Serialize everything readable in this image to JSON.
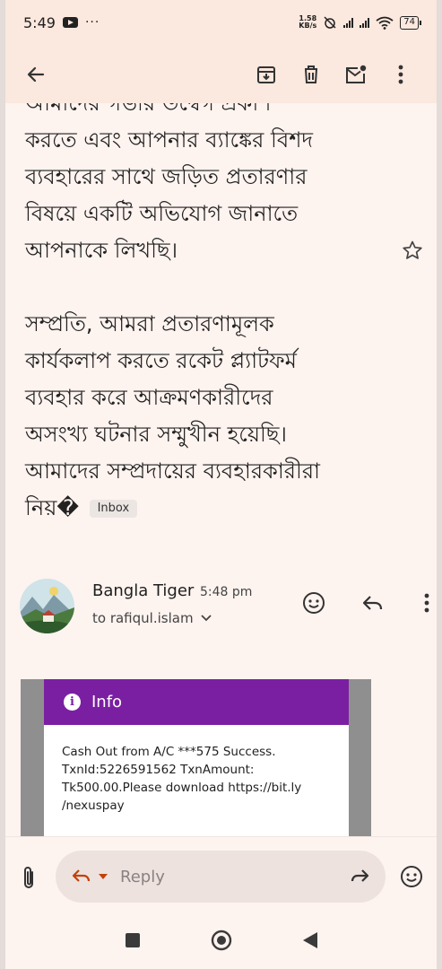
{
  "status_bar": {
    "time": "5:49",
    "more": "···",
    "network_speed_value": "1.58",
    "network_speed_unit": "KB/s",
    "battery": "74"
  },
  "app_bar": {
    "back_icon": "arrow-left-icon",
    "archive_icon": "archive-icon",
    "delete_icon": "trash-icon",
    "mark_unread_icon": "mail-unread-icon",
    "more_icon": "more-vert-icon"
  },
  "email": {
    "body_partial_top": "আমাদের গভীর উদ্বেগ প্রকাশ",
    "paragraph1_lines": [
      "করতে এবং আপনার ব্যাঙ্কের বিশদ",
      "ব্যবহারের সাথে জড়িত প্রতারণার",
      "বিষয়ে একটি অভিযোগ জানাতে",
      "আপনাকে লিখছি।"
    ],
    "paragraph2_lines": [
      "সম্প্রতি, আমরা প্রতারণামূলক",
      "কার্যকলাপ করতে রকেট প্ল্যাটফর্ম",
      "ব্যবহার করে আক্রমণকারীদের",
      "অসংখ্য ঘটনার সম্মুখীন হয়েছি।",
      "আমাদের সম্প্রদায়ের ব্যবহারকারীরা"
    ],
    "last_line": "নিয়�",
    "label_chip": "Inbox"
  },
  "message": {
    "sender": "Bangla Tiger",
    "time": "5:48 pm",
    "recipient": "to rafiqul.islam"
  },
  "card": {
    "title": "Info",
    "lines": [
      "Cash Out from A/C ***575 Success.",
      "TxnId:5226591562 TxnAmount:",
      "Tk500.00.Please download https://bit.ly",
      "/nexuspay"
    ]
  },
  "reply_bar": {
    "placeholder": "Reply"
  },
  "colors": {
    "background": "#fdf3ef",
    "header": "#fbe8de",
    "card_header": "#7b1fa2"
  }
}
